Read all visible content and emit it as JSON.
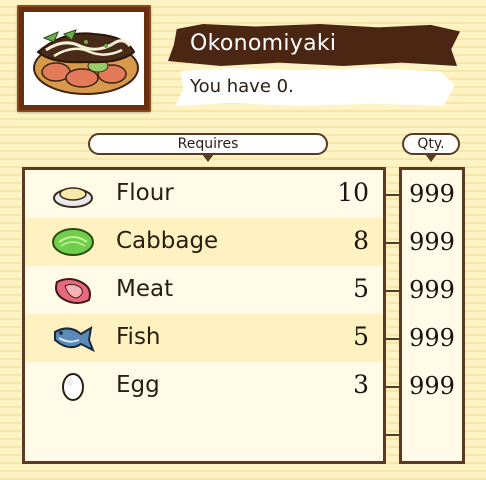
{
  "item": {
    "name": "Okonomiyaki",
    "owned_text": "You have 0.",
    "icon": "okonomiyaki-icon"
  },
  "headers": {
    "requires": "Requires",
    "qty": "Qty."
  },
  "ingredients": [
    {
      "name": "Flour",
      "required": "10",
      "qty": "999",
      "icon": "flour-icon"
    },
    {
      "name": "Cabbage",
      "required": "8",
      "qty": "999",
      "icon": "cabbage-icon"
    },
    {
      "name": "Meat",
      "required": "5",
      "qty": "999",
      "icon": "meat-icon"
    },
    {
      "name": "Fish",
      "required": "5",
      "qty": "999",
      "icon": "fish-icon"
    },
    {
      "name": "Egg",
      "required": "3",
      "qty": "999",
      "icon": "egg-icon"
    }
  ],
  "colors": {
    "background": "#fdf3c4",
    "frame": "#6a2e10",
    "banner": "#4b2612",
    "row_alt": "#fff2c0",
    "border": "#5a3a22"
  }
}
